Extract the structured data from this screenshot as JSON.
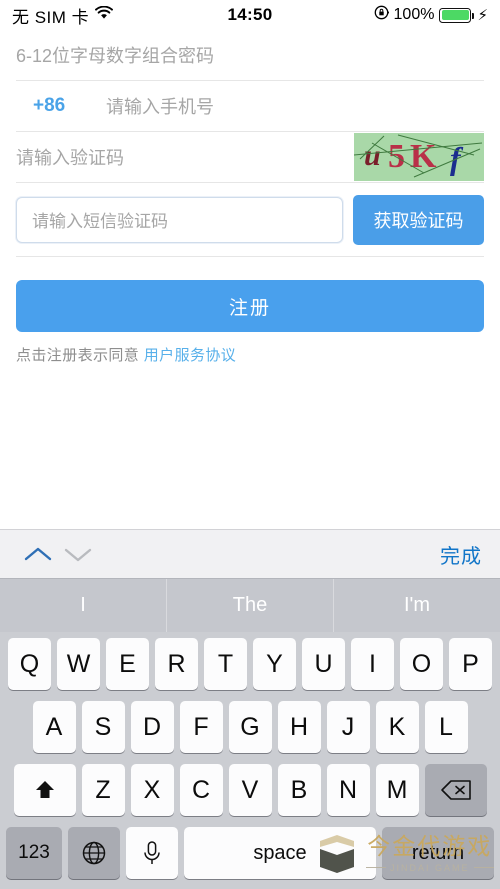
{
  "status_bar": {
    "carrier": "无 SIM 卡",
    "wifi_icon": "wifi-icon",
    "time": "14:50",
    "rotation_lock_icon": "rotation-lock-icon",
    "battery_percent": "100%",
    "battery_icon": "battery-icon",
    "charging_icon": "charging-bolt-icon",
    "battery_color": "#4cd964"
  },
  "form": {
    "password_placeholder": "6-12位字母数字组合密码",
    "country_code": "+86",
    "phone_placeholder": "请输入手机号",
    "captcha_placeholder": "请输入验证码",
    "captcha_image": {
      "name": "captcha-image",
      "text": "u5Kf",
      "background": "#a9d8a8",
      "chars": [
        {
          "ch": "u",
          "color": "#7a1f2b"
        },
        {
          "ch": "5",
          "color": "#b93048"
        },
        {
          "ch": "K",
          "color": "#b93048"
        },
        {
          "ch": "f",
          "color": "#1b2d8f"
        }
      ]
    },
    "sms_placeholder": "请输入短信验证码",
    "get_code_label": "获取验证码",
    "register_label": "注册",
    "agree_prefix": "点击注册表示同意 ",
    "agreement_link": "用户服务协议",
    "accent_color": "#49a0ed"
  },
  "keyboard": {
    "accessory": {
      "prev_icon": "chevron-up-icon",
      "next_icon": "chevron-down-icon",
      "done_label": "完成",
      "done_color": "#1175c8"
    },
    "predictions": [
      "I",
      "The",
      "I'm"
    ],
    "rows": {
      "row1": [
        "Q",
        "W",
        "E",
        "R",
        "T",
        "Y",
        "U",
        "I",
        "O",
        "P"
      ],
      "row2": [
        "A",
        "S",
        "D",
        "F",
        "G",
        "H",
        "J",
        "K",
        "L"
      ],
      "row3": [
        "Z",
        "X",
        "C",
        "V",
        "B",
        "N",
        "M"
      ]
    },
    "shift_icon": "shift-arrow-icon",
    "delete_icon": "backspace-icon",
    "numbers_label": "123",
    "globe_icon": "globe-icon",
    "mic_icon": "microphone-icon",
    "space_label": "space",
    "return_label": "return"
  },
  "watermark": {
    "logo_icon": "jindai-shield-logo-icon",
    "cn_text": "今金代游戏",
    "en_text": "JINDAI GAME",
    "color": "#c9a85e"
  }
}
